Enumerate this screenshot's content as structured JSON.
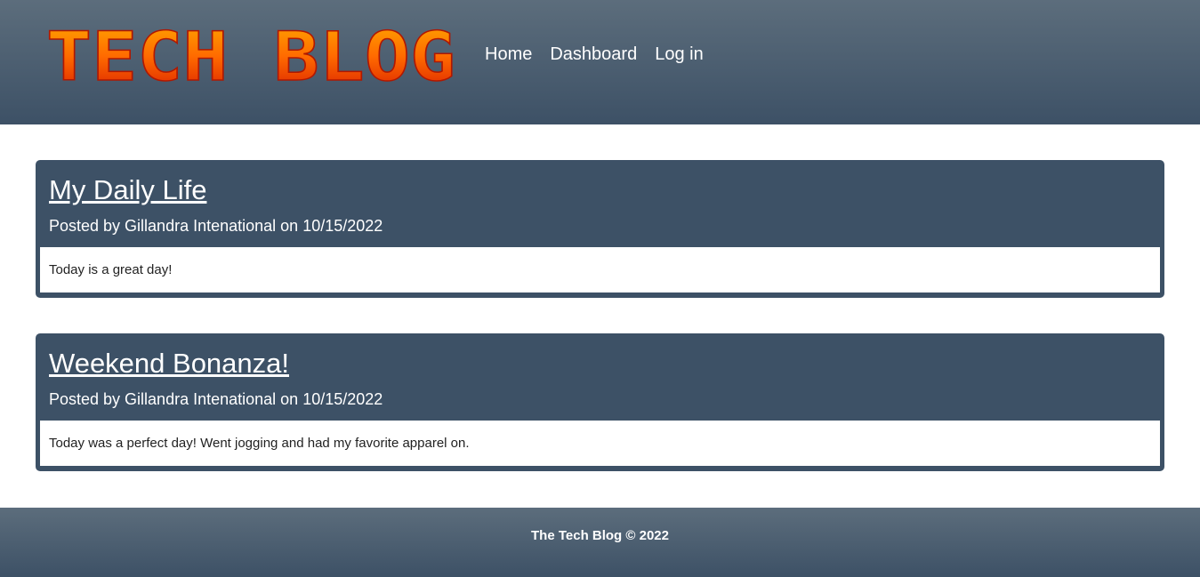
{
  "header": {
    "logo_text": "TECH BLOG",
    "nav": [
      {
        "label": "Home"
      },
      {
        "label": "Dashboard"
      },
      {
        "label": "Log in"
      }
    ]
  },
  "posts": [
    {
      "title": "My Daily Life",
      "meta": "Posted by Gillandra Intenational on 10/15/2022",
      "body": "Today is a great day!"
    },
    {
      "title": "Weekend Bonanza!",
      "meta": "Posted by Gillandra Intenational on 10/15/2022",
      "body": "Today was a perfect day! Went jogging and had my favorite apparel on."
    }
  ],
  "footer": {
    "text": "The Tech Blog © 2022"
  },
  "colors": {
    "header_top": "#5c6d7c",
    "header_bottom": "#3d5166",
    "card": "#3d5166",
    "logo_orange": "#ff9a00",
    "logo_red": "#d81e00"
  }
}
